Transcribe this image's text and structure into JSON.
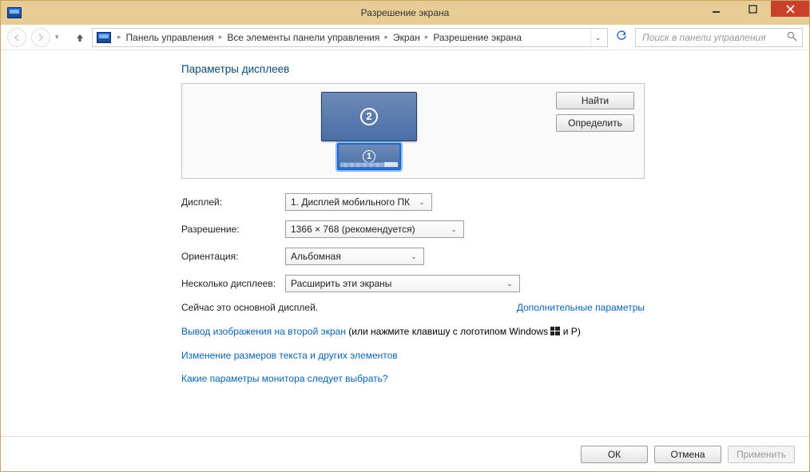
{
  "window": {
    "title": "Разрешение экрана"
  },
  "breadcrumb": {
    "items": [
      "Панель управления",
      "Все элементы панели управления",
      "Экран",
      "Разрешение экрана"
    ]
  },
  "search": {
    "placeholder": "Поиск в панели управления"
  },
  "heading": "Параметры дисплеев",
  "picker": {
    "buttons": {
      "find": "Найти",
      "identify": "Определить"
    },
    "monitors": {
      "m1": "1",
      "m2": "2"
    }
  },
  "form": {
    "display_label": "Дисплей:",
    "display_value": "1. Дисплей мобильного ПК",
    "resolution_label": "Разрешение:",
    "resolution_value": "1366 × 768 (рекомендуется)",
    "orientation_label": "Ориентация:",
    "orientation_value": "Альбомная",
    "multi_label": "Несколько дисплеев:",
    "multi_value": "Расширить эти экраны"
  },
  "status": {
    "main_display": "Сейчас это основной дисплей.",
    "advanced_link": "Дополнительные параметры"
  },
  "links": {
    "project_link": "Вывод изображения на второй экран",
    "project_suffix_a": " (или нажмите клавишу с логотипом Windows ",
    "project_suffix_b": " и P)",
    "text_size": "Изменение размеров текста и других элементов",
    "which_params": "Какие параметры монитора следует выбрать?"
  },
  "footer": {
    "ok": "ОК",
    "cancel": "Отмена",
    "apply": "Применить"
  }
}
